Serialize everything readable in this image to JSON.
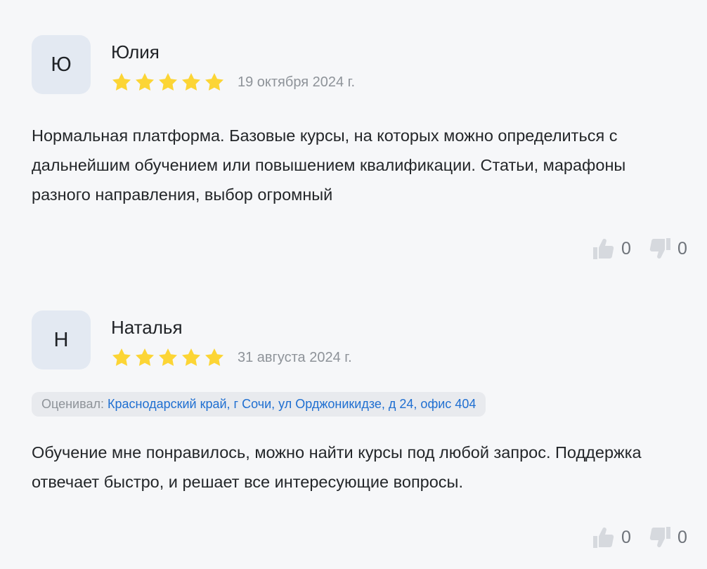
{
  "icons": {
    "star": "star-icon",
    "like": "thumbs-up-icon",
    "dislike": "thumbs-down-icon"
  },
  "colors": {
    "star": "#fcd535",
    "avatar_bg": "#e3e9f2",
    "link": "#1f6fd1",
    "muted": "#8e9399",
    "vote_icon": "#d6d9de"
  },
  "reviews": [
    {
      "initial": "Ю",
      "author": "Юлия",
      "rating": 5,
      "date": "19 октября 2024 г.",
      "text": "Нормальная платформа. Базовые курсы, на которых можно определиться с дальнейшим обучением или повышением квалификации. Статьи, марафоны разного направления, выбор огромный",
      "likes": "0",
      "dislikes": "0"
    },
    {
      "initial": "Н",
      "author": "Наталья",
      "rating": 5,
      "date": "31 августа 2024 г.",
      "address_label": "Оценивал:",
      "address": "Краснодарский край, г Сочи, ул Орджоникидзе, д 24, офис 404",
      "text": "Обучение мне понравилось, можно найти курсы под любой запрос. Поддержка отвечает быстро, и решает все интересующие вопросы.",
      "likes": "0",
      "dislikes": "0"
    }
  ]
}
